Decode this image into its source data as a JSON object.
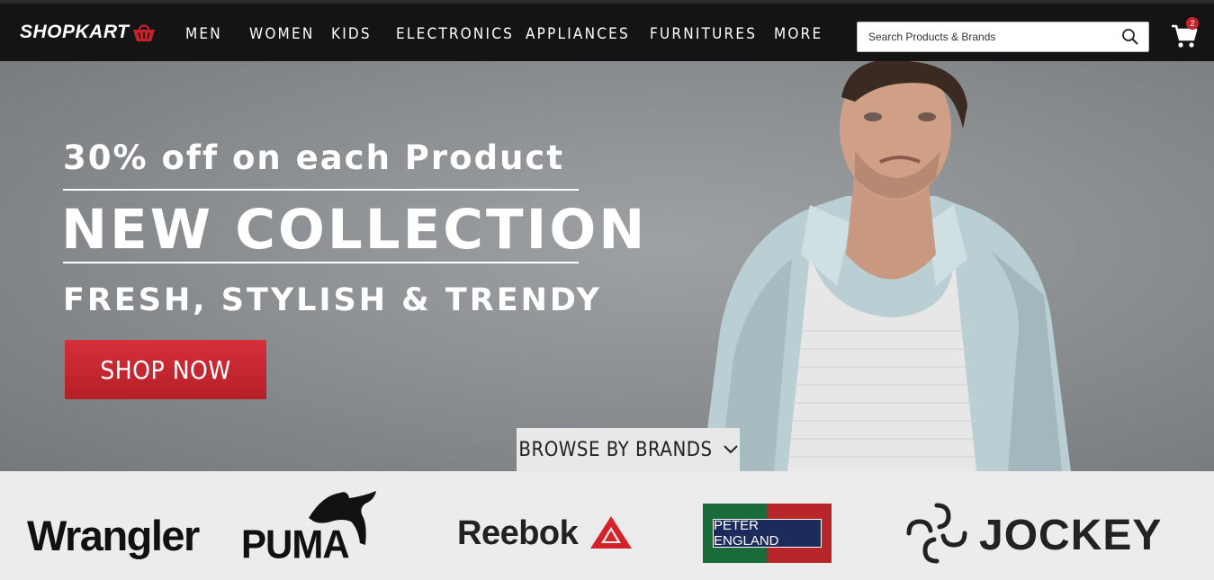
{
  "navbar": {
    "brand": "SHOPKART",
    "links": [
      "MEN",
      "WOMEN",
      "KIDS",
      "ELECTRONICS",
      "APPLIANCES",
      "FURNITURES",
      "MORE"
    ],
    "search_placeholder": "Search Products & Brands",
    "cart_count": "2"
  },
  "hero": {
    "promo": "30% off on each Product",
    "headline": "NEW COLLECTION",
    "subhead": "FRESH, STYLISH & TRENDY",
    "cta": "SHOP NOW",
    "browse": "BROWSE BY BRANDS"
  },
  "brands": {
    "items": [
      "Wrangler",
      "PUMA",
      "Reebok",
      "PETER ENGLAND",
      "JOCKEY"
    ]
  },
  "colors": {
    "nav_bg": "#141414",
    "accent_red": "#c8232c",
    "hero_bg": "#8e9295",
    "brand_strip": "#ececec"
  }
}
